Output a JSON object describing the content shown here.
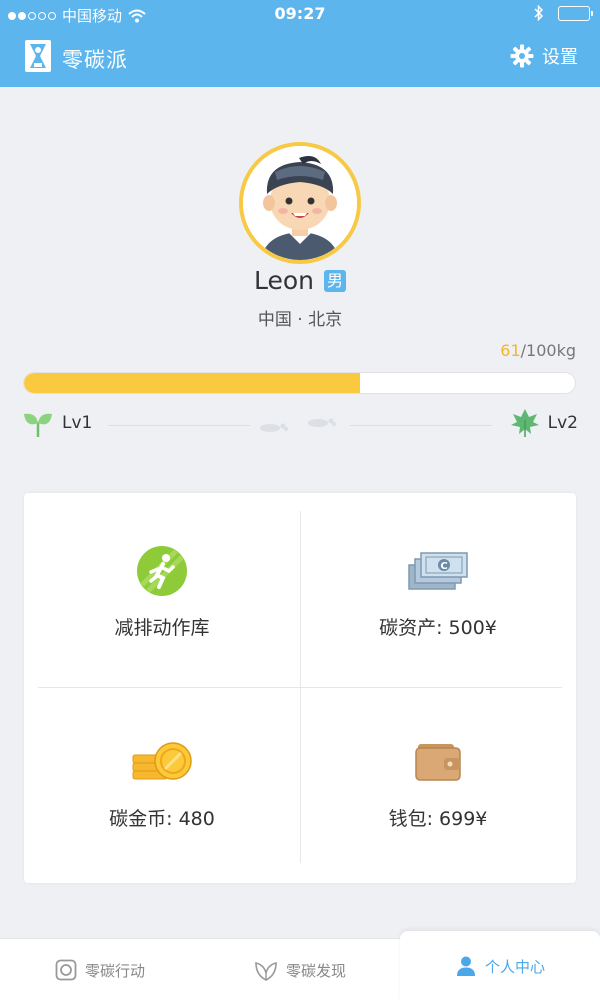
{
  "status_bar": {
    "carrier": "中国移动",
    "time": "09:27",
    "signal_dots": 5,
    "signal_filled": 2
  },
  "header": {
    "app_title": "零碳派",
    "settings_label": "设置",
    "logo_icon": "hourglass-icon",
    "settings_icon": "gear-icon"
  },
  "profile": {
    "name": "Leon",
    "gender": "男",
    "location": "中国 · 北京"
  },
  "progress": {
    "current": "61",
    "target_suffix": "/100kg",
    "fraction": 0.61
  },
  "levels": {
    "current": "Lv1",
    "next": "Lv2"
  },
  "grid": {
    "actions_label": "减排动作库",
    "carbon_assets_label": "碳资产: 500¥",
    "carbon_coins_label": "碳金币: 480",
    "wallet_label": "钱包: 699¥"
  },
  "tabs": [
    {
      "label": "零碳行动",
      "icon": "camera-icon"
    },
    {
      "label": "零碳发现",
      "icon": "leaf-icon"
    },
    {
      "label": "个人中心",
      "icon": "person-icon"
    }
  ],
  "colors": {
    "primary": "#5db5ee",
    "progress_fill": "#fbc940",
    "accent_text": "#f5b52a",
    "active_tab": "#4aa8ea"
  }
}
